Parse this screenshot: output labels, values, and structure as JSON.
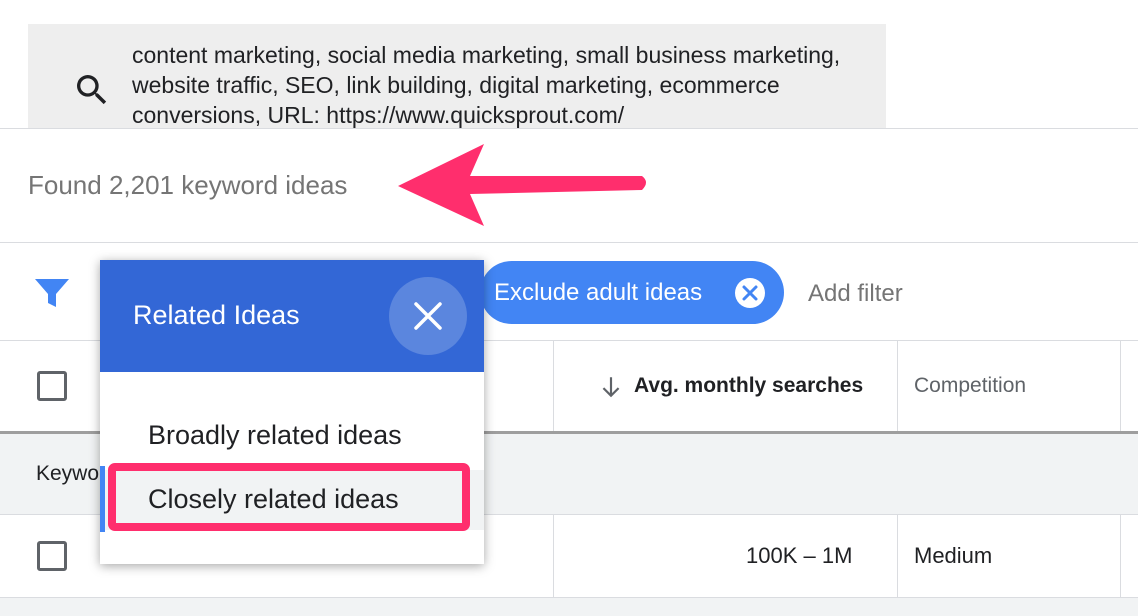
{
  "search": {
    "text": "content marketing, social media marketing, small business marketing, website traffic, SEO, link building, digital marketing, ecommerce conversions, URL: https://www.quicksprout.com/"
  },
  "results": {
    "found_text": "Found 2,201 keyword ideas"
  },
  "filters": {
    "chip_label": "Exclude adult ideas",
    "add_filter_label": "Add filter"
  },
  "table": {
    "headers": {
      "avg_monthly_searches": "Avg. monthly searches",
      "competition": "Competition"
    },
    "group_label": "Keywo",
    "rows": [
      {
        "avg_monthly_searches": "100K – 1M",
        "competition": "Medium"
      }
    ]
  },
  "popup": {
    "title": "Related Ideas",
    "options": [
      "Broadly related ideas",
      "Closely related ideas"
    ]
  },
  "colors": {
    "chip_blue": "#4285f4",
    "popup_header_blue": "#3367d6",
    "annotation_pink": "#ff2e6d"
  },
  "icons": {
    "search": "search-icon",
    "filter": "filter-icon",
    "close": "close-icon",
    "sort": "arrow-down-icon"
  }
}
